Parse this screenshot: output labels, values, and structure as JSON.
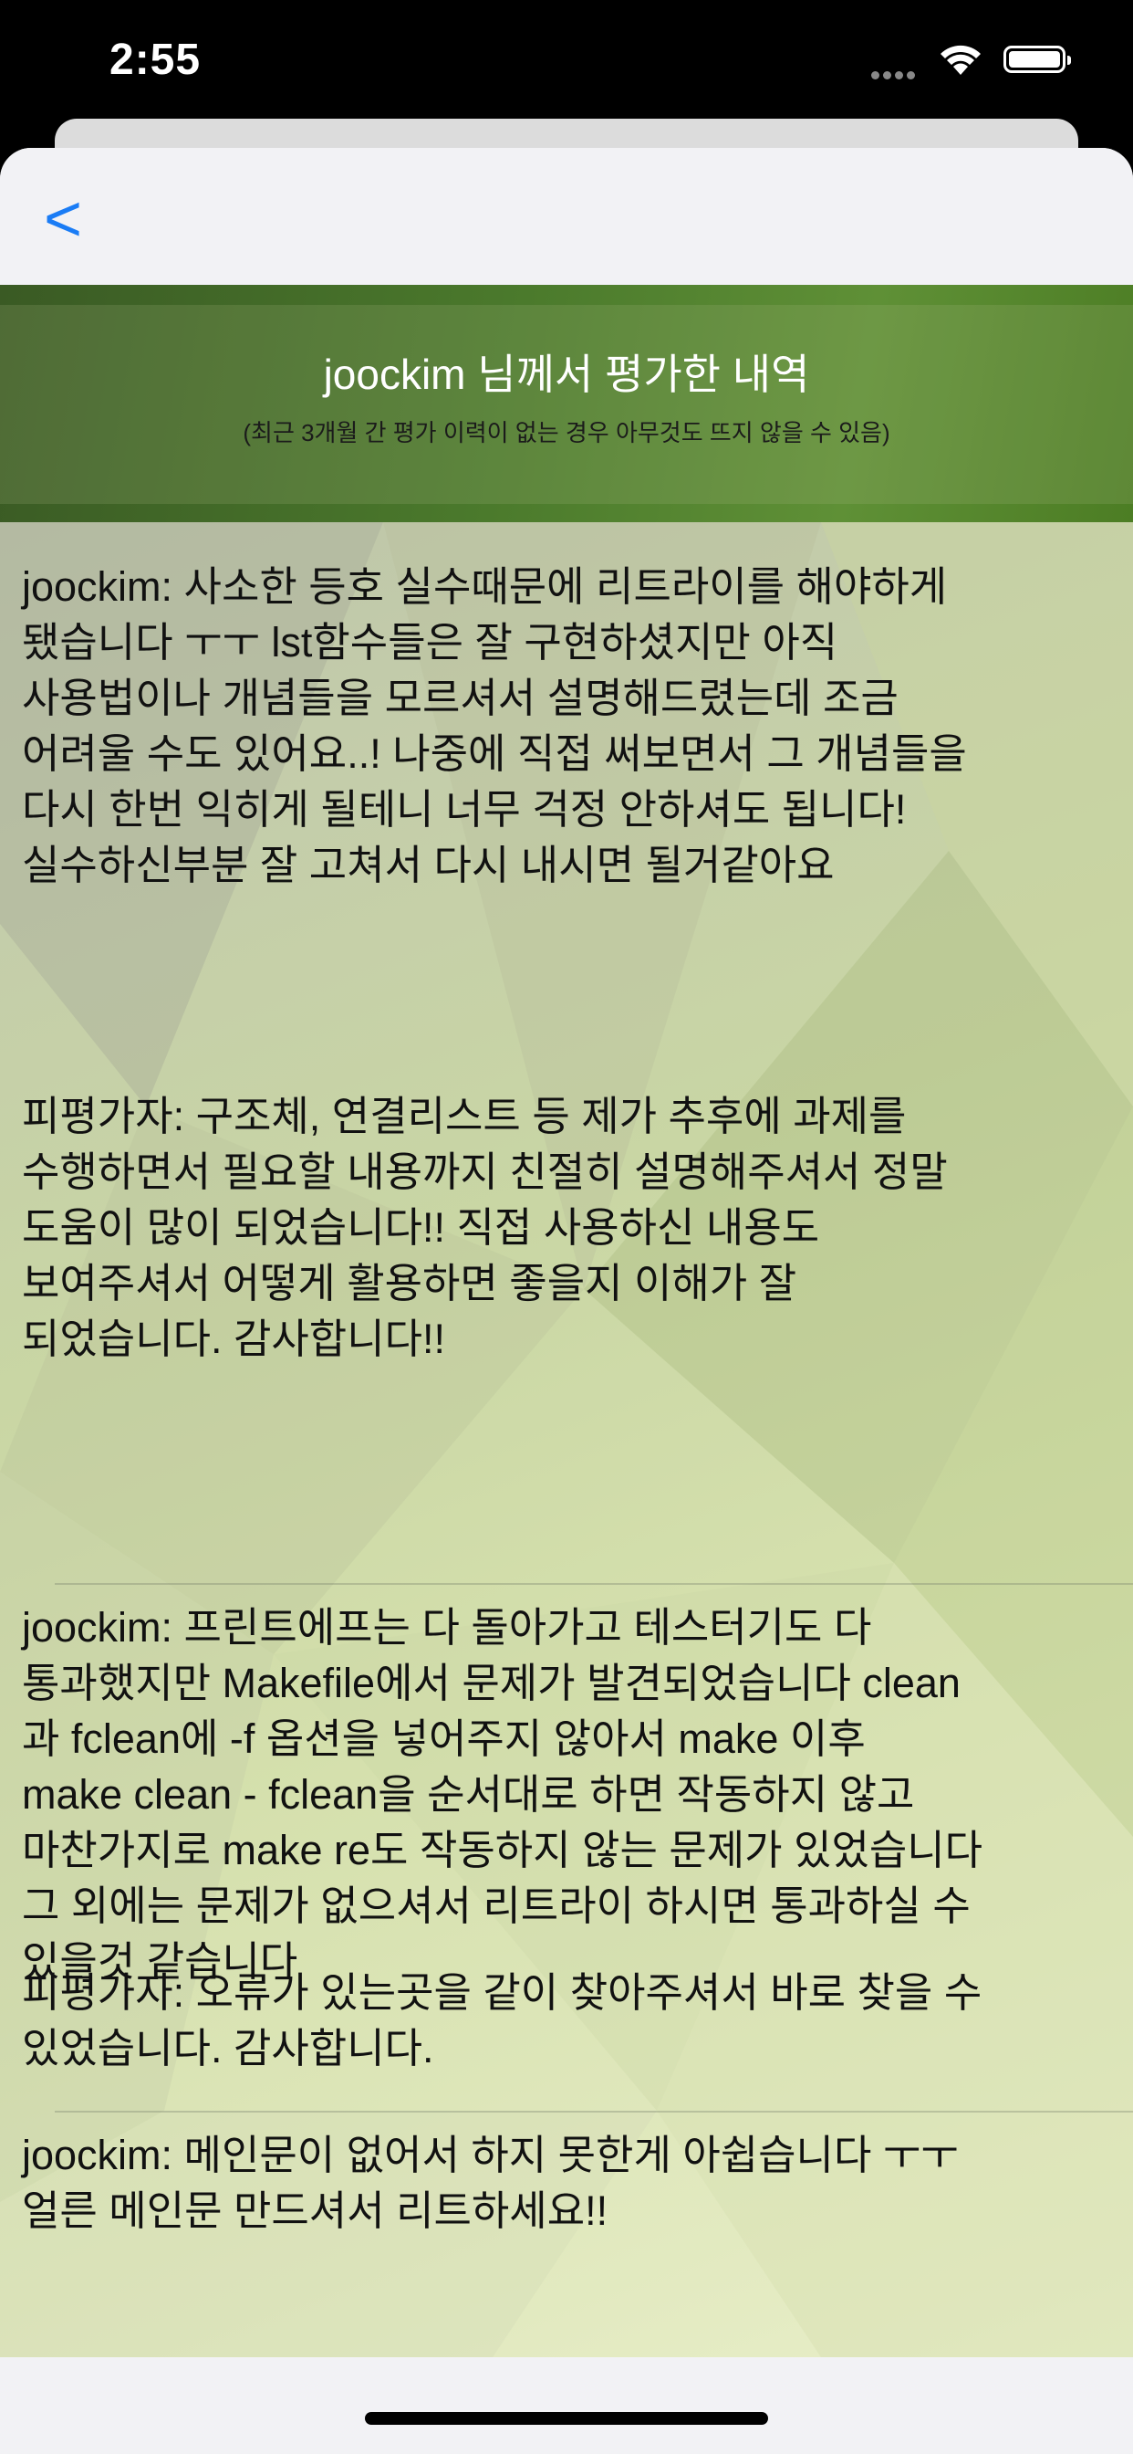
{
  "status_bar": {
    "time": "2:55"
  },
  "nav": {
    "back_label": "<"
  },
  "banner": {
    "title": "joockim 님께서 평가한 내역",
    "subtitle": "(최근 3개월 간 평가 이력이 없는 경우 아무것도 뜨지 않을 수 있음)"
  },
  "reviews": [
    {
      "evaluator": "joockim:  사소한 등호 실수때문에 리트라이를 해야하게\n됐습니다 ㅜㅜ lst함수들은 잘 구현하셨지만 아직\n사용법이나 개념들을 모르셔서 설명해드렸는데 조금\n어려울 수도 있어요..! 나중에 직접 써보면서 그 개념들을\n다시 한번 익히게 될테니 너무 걱정 안하셔도 됩니다!\n실수하신부분 잘 고쳐서 다시 내시면 될거같아요",
      "evaluatee": "피평가자:  구조체, 연결리스트 등 제가 추후에 과제를\n수행하면서 필요할 내용까지 친절히 설명해주셔서 정말\n도움이 많이 되었습니다!! 직접 사용하신 내용도\n보여주셔서 어떻게 활용하면 좋을지 이해가 잘\n되었습니다. 감사합니다!!"
    },
    {
      "evaluator": "joockim:  프린트에프는 다 돌아가고 테스터기도 다\n통과했지만 Makefile에서 문제가 발견되었습니다 clean\n과 fclean에 -f 옵션을 넣어주지 않아서 make 이후\nmake clean - fclean을 순서대로 하면 작동하지 않고\n마찬가지로 make re도 작동하지 않는 문제가 있었습니다\n그 외에는 문제가 없으셔서 리트라이 하시면 통과하실 수\n있을것 같습니다",
      "evaluatee": "피평가자:  오류가 있는곳을 같이 찾아주셔서 바로 찾을 수\n있었습니다. 감사합니다."
    },
    {
      "evaluator": "joockim:  메인문이 없어서 하지 못한게 아쉽습니다 ㅜㅜ\n얼른 메인문 만드셔서 리트하세요!!"
    }
  ]
}
